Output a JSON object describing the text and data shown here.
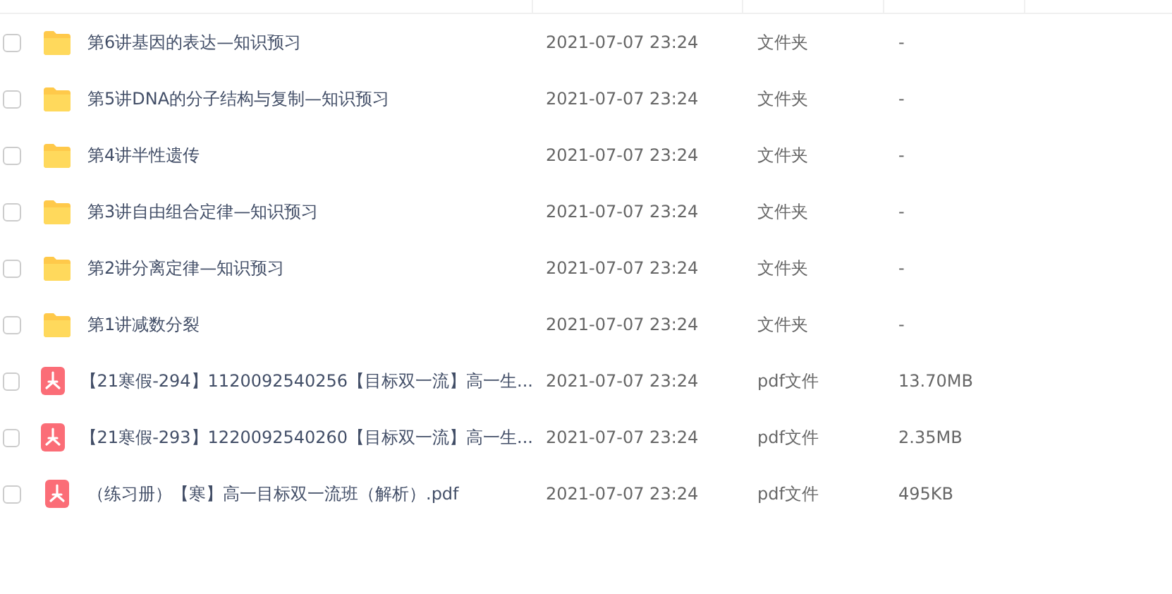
{
  "files": [
    {
      "kind": "folder",
      "name": "第6讲基因的表达—知识预习",
      "modified": "2021-07-07 23:24",
      "type": "文件夹",
      "size": "-",
      "checked": false
    },
    {
      "kind": "folder",
      "name": "第5讲DNA的分子结构与复制—知识预习",
      "modified": "2021-07-07 23:24",
      "type": "文件夹",
      "size": "-",
      "checked": false
    },
    {
      "kind": "folder",
      "name": "第4讲半性遗传",
      "modified": "2021-07-07 23:24",
      "type": "文件夹",
      "size": "-",
      "checked": false
    },
    {
      "kind": "folder",
      "name": "第3讲自由组合定律—知识预习",
      "modified": "2021-07-07 23:24",
      "type": "文件夹",
      "size": "-",
      "checked": false
    },
    {
      "kind": "folder",
      "name": "第2讲分离定律—知识预习",
      "modified": "2021-07-07 23:24",
      "type": "文件夹",
      "size": "-",
      "checked": false
    },
    {
      "kind": "folder",
      "name": "第1讲减数分裂",
      "modified": "2021-07-07 23:24",
      "type": "文件夹",
      "size": "-",
      "checked": false
    },
    {
      "kind": "pdf",
      "name": "【21寒假-294】1120092540256【目标双一流】高一生...",
      "modified": "2021-07-07 23:24",
      "type": "pdf文件",
      "size": "13.70MB",
      "checked": false
    },
    {
      "kind": "pdf",
      "name": "【21寒假-293】1220092540260【目标双一流】高一生...",
      "modified": "2021-07-07 23:24",
      "type": "pdf文件",
      "size": "2.35MB",
      "checked": false
    },
    {
      "kind": "pdf",
      "name": "（练习册）【寒】高一目标双一流班（解析）.pdf",
      "modified": "2021-07-07 23:24",
      "type": "pdf文件",
      "size": "495KB",
      "checked": false
    }
  ]
}
